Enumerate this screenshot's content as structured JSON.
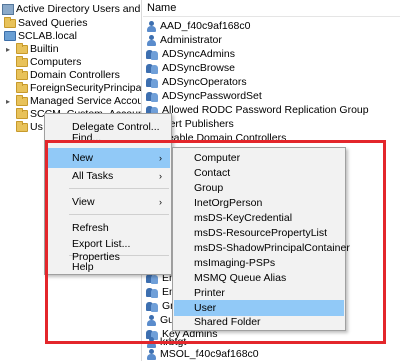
{
  "tree": {
    "items": [
      {
        "label": "Active Directory Users and Compute"
      },
      {
        "label": "Saved Queries"
      },
      {
        "label": "SCLAB.local"
      },
      {
        "label": "Builtin"
      },
      {
        "label": "Computers"
      },
      {
        "label": "Domain Controllers"
      },
      {
        "label": "ForeignSecurityPrincipals"
      },
      {
        "label": "Managed Service Accounts"
      },
      {
        "label": "SCCM_Custom_Accounts"
      },
      {
        "label": "Us"
      }
    ]
  },
  "list": {
    "header": "Name",
    "rows": [
      {
        "label": "AAD_f40c9af168c0",
        "icon": "user-icon"
      },
      {
        "label": "Administrator",
        "icon": "user-icon"
      },
      {
        "label": "ADSyncAdmins",
        "icon": "group-icon"
      },
      {
        "label": "ADSyncBrowse",
        "icon": "group-icon"
      },
      {
        "label": "ADSyncOperators",
        "icon": "group-icon"
      },
      {
        "label": "ADSyncPasswordSet",
        "icon": "group-icon"
      },
      {
        "label": "Allowed RODC Password Replication Group",
        "icon": "group-icon"
      },
      {
        "label": "Cert Publishers",
        "icon": "group-icon"
      },
      {
        "label": "neable Domain Controllers",
        "icon": "group-icon"
      },
      {
        "label": "Ent",
        "icon": "group-icon"
      },
      {
        "label": "Ent",
        "icon": "group-icon"
      },
      {
        "label": "Gro",
        "icon": "group-icon"
      },
      {
        "label": "Gu",
        "icon": "user-icon"
      },
      {
        "label": "Key Admins",
        "icon": "group-icon"
      },
      {
        "label": "krbtgt",
        "icon": "user-icon"
      },
      {
        "label": "MSOL_f40c9af168c0",
        "icon": "user-icon"
      }
    ]
  },
  "context_menu": {
    "items": [
      {
        "label": "Delegate Control..."
      },
      {
        "label": "Find..."
      },
      {
        "label": "New"
      },
      {
        "label": "All Tasks"
      },
      {
        "label": "View"
      },
      {
        "label": "Refresh"
      },
      {
        "label": "Export List..."
      },
      {
        "label": "Properties"
      },
      {
        "label": "Help"
      }
    ],
    "highlighted": "New"
  },
  "submenu": {
    "items": [
      {
        "label": "Computer"
      },
      {
        "label": "Contact"
      },
      {
        "label": "Group"
      },
      {
        "label": "InetOrgPerson"
      },
      {
        "label": "msDS-KeyCredential"
      },
      {
        "label": "msDS-ResourcePropertyList"
      },
      {
        "label": "msDS-ShadowPrincipalContainer"
      },
      {
        "label": "msImaging-PSPs"
      },
      {
        "label": "MSMQ Queue Alias"
      },
      {
        "label": "Printer"
      },
      {
        "label": "User"
      },
      {
        "label": "Shared Folder"
      }
    ],
    "highlighted": "User"
  },
  "colors": {
    "highlight": "#91c9f7",
    "annotation_box": "#e3262b"
  }
}
